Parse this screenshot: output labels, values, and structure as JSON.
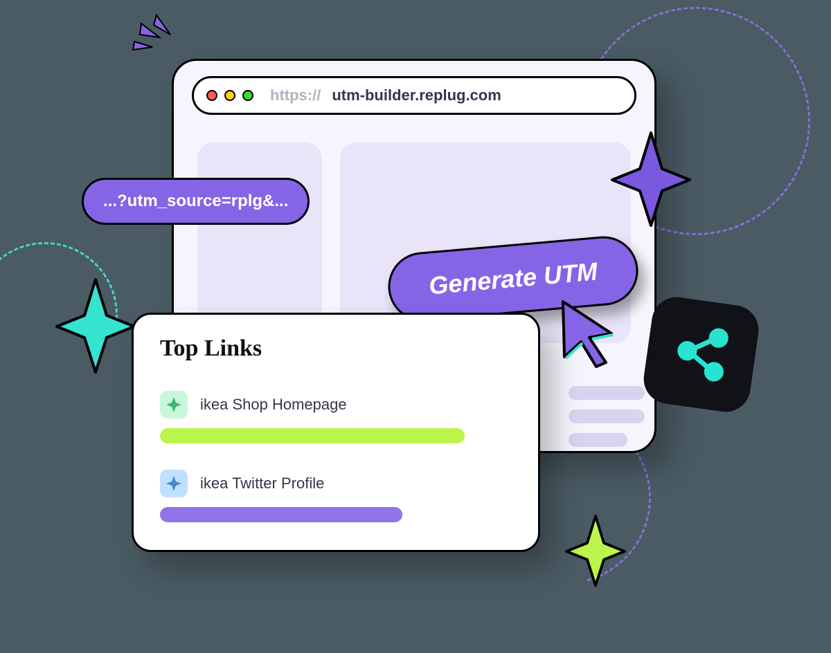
{
  "url": {
    "scheme": "https://",
    "host": "utm-builder.replug.com"
  },
  "utm_pill": "...?utm_source=rplg&...",
  "generate_button": "Generate UTM",
  "top_links": {
    "title": "Top Links",
    "items": [
      {
        "label": "ikea Shop Homepage",
        "bar_color": "lime",
        "bar_width_pct": 85
      },
      {
        "label": "ikea Twitter Profile",
        "bar_color": "purple",
        "bar_width_pct": 68
      }
    ]
  },
  "icons": {
    "traffic_lights": [
      "close-icon",
      "minimize-icon",
      "zoom-icon"
    ],
    "cursor": "pointer-cursor-icon",
    "share": "share-icon",
    "sparkle_purple": "sparkle-decor-icon",
    "sparkle_teal": "sparkle-decor-icon",
    "sparkle_lime": "sparkle-decor-icon",
    "burst": "burst-decor-icon"
  },
  "colors": {
    "accent_purple": "#8664e6",
    "accent_lime": "#bbf44a",
    "accent_teal": "#46e2cf",
    "page_bg": "#4a5b63"
  }
}
